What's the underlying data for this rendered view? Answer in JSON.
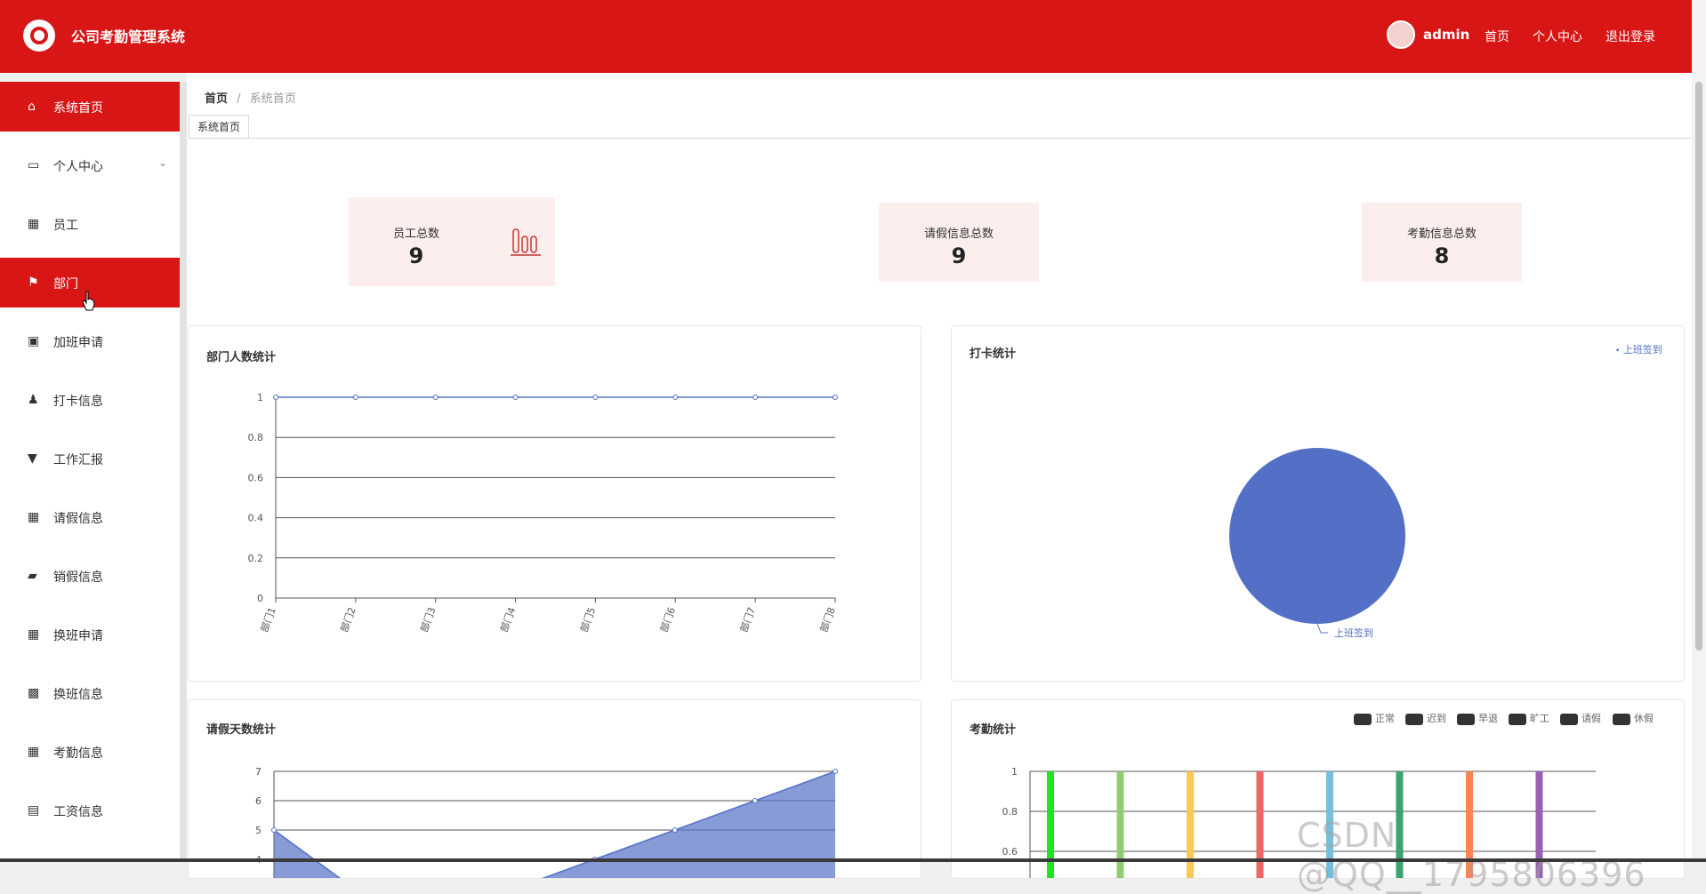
{
  "header": {
    "title": "公司考勤管理系统",
    "user": "admin",
    "links": [
      "首页",
      "个人中心",
      "退出登录"
    ]
  },
  "sidebar": {
    "items": [
      {
        "label": "系统首页",
        "icon": "home-icon",
        "active": true
      },
      {
        "label": "个人中心",
        "icon": "card-icon",
        "expandable": true
      },
      {
        "label": "员工",
        "icon": "grid-icon"
      },
      {
        "label": "部门",
        "icon": "flag-icon",
        "active": true
      },
      {
        "label": "加班申请",
        "icon": "clipboard-icon"
      },
      {
        "label": "打卡信息",
        "icon": "person-icon"
      },
      {
        "label": "工作汇报",
        "icon": "brush-icon"
      },
      {
        "label": "请假信息",
        "icon": "grid-icon"
      },
      {
        "label": "销假信息",
        "icon": "briefcase-icon"
      },
      {
        "label": "换班申请",
        "icon": "grid-icon"
      },
      {
        "label": "换班信息",
        "icon": "grid9-icon"
      },
      {
        "label": "考勤信息",
        "icon": "grid-icon"
      },
      {
        "label": "工资信息",
        "icon": "list-icon"
      }
    ]
  },
  "breadcrumb": {
    "home": "首页",
    "separator": "/",
    "current": "系统首页"
  },
  "tab": "系统首页",
  "stats": [
    {
      "title": "员工总数",
      "value": "9"
    },
    {
      "title": "请假信息总数",
      "value": "9"
    },
    {
      "title": "考勤信息总数",
      "value": "8"
    }
  ],
  "panels": {
    "dept": "部门人数统计",
    "punch": "打卡统计",
    "leave": "请假天数统计",
    "attendance": "考勤统计"
  },
  "chart_data": [
    {
      "type": "line",
      "title": "部门人数统计",
      "categories": [
        "部门1",
        "部门2",
        "部门3",
        "部门4",
        "部门5",
        "部门6",
        "部门7",
        "部门8"
      ],
      "values": [
        1,
        1,
        1,
        1,
        1,
        1,
        1,
        1
      ],
      "yticks": [
        "0",
        "0.2",
        "0.4",
        "0.6",
        "0.8",
        "1"
      ],
      "ylim": [
        0,
        1
      ],
      "color": "#5470c6"
    },
    {
      "type": "pie",
      "title": "打卡统计",
      "legend": [
        "上班签到"
      ],
      "slices": [
        {
          "name": "上班签到",
          "value": 1
        }
      ],
      "color": "#5470c6"
    },
    {
      "type": "area",
      "title": "请假天数统计",
      "values": [
        5,
        3,
        3,
        3,
        4,
        5,
        6,
        7
      ],
      "yticks": [
        "4",
        "5",
        "6",
        "7"
      ],
      "ylim": [
        0,
        7
      ],
      "color": "#5470c6"
    },
    {
      "type": "bar",
      "title": "考勤统计",
      "legend": [
        "正常",
        "迟到",
        "早退",
        "旷工",
        "请假",
        "休假"
      ],
      "yticks": [
        "0.6",
        "0.8",
        "1"
      ],
      "bar_colors": [
        "#1ee61e",
        "#91cc75",
        "#fac858",
        "#ee6666",
        "#73c0de",
        "#3ba272",
        "#fc8452",
        "#9a60b4"
      ],
      "values": [
        1,
        1,
        1,
        1,
        1,
        1,
        1,
        1
      ]
    }
  ],
  "watermark": "CSDN @QQ__1795806396"
}
